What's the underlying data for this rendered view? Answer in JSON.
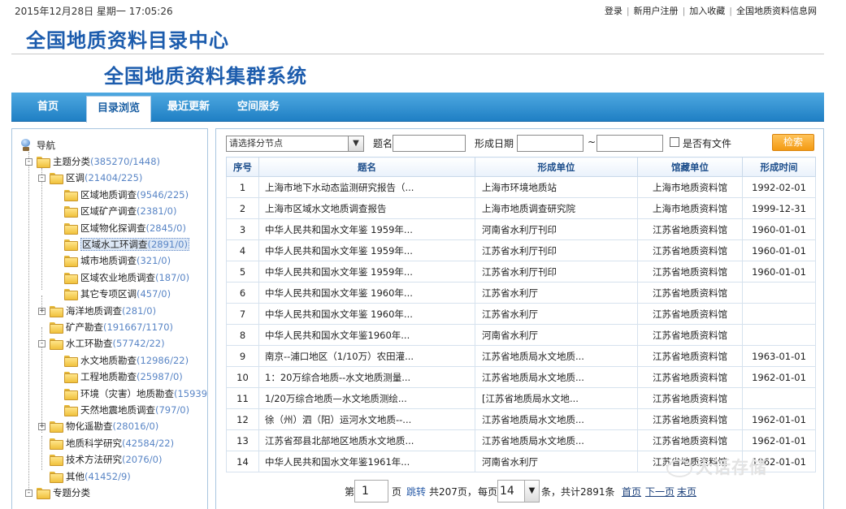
{
  "topbar": {
    "datetime": "2015年12月28日 星期一 17:05:26",
    "links": [
      "登录",
      "新用户注册",
      "加入收藏",
      "全国地质资料信息网"
    ]
  },
  "header": {
    "title1": "全国地质资料目录中心",
    "title2": "全国地质资料集群系统"
  },
  "nav": {
    "tabs": [
      "首页",
      "目录浏览",
      "最近更新",
      "空间服务"
    ],
    "active_index": 1
  },
  "sidebar": {
    "root": "导航",
    "nodes": [
      {
        "label": "主题分类",
        "count": "(385270/1448)"
      },
      {
        "label": "区调",
        "count": "(21404/225)"
      },
      {
        "label": "区域地质调查",
        "count": "(9546/225)"
      },
      {
        "label": "区域矿产调查",
        "count": "(2381/0)"
      },
      {
        "label": "区域物化探调查",
        "count": "(2845/0)"
      },
      {
        "label": "区域水工环调查",
        "count": "(2891/0)"
      },
      {
        "label": "城市地质调查",
        "count": "(321/0)"
      },
      {
        "label": "区域农业地质调查",
        "count": "(187/0)"
      },
      {
        "label": "其它专项区调",
        "count": "(457/0)"
      },
      {
        "label": "海洋地质调查",
        "count": "(281/0)"
      },
      {
        "label": "矿产勘查",
        "count": "(191667/1170)"
      },
      {
        "label": "水工环勘查",
        "count": "(57742/22)"
      },
      {
        "label": "水文地质勘查",
        "count": "(12986/22)"
      },
      {
        "label": "工程地质勘查",
        "count": "(25987/0)"
      },
      {
        "label": "环境（灾害）地质勘查",
        "count": "(15939"
      },
      {
        "label": "天然地震地质调查",
        "count": "(797/0)"
      },
      {
        "label": "物化遥勘查",
        "count": "(28016/0)"
      },
      {
        "label": "地质科学研究",
        "count": "(42584/22)"
      },
      {
        "label": "技术方法研究",
        "count": "(2076/0)"
      },
      {
        "label": "其他",
        "count": "(41452/9)"
      },
      {
        "label": "专题分类",
        "count": ""
      }
    ]
  },
  "filter": {
    "section_placeholder": "请选择分节点",
    "title_label": "题名",
    "date_label": "形成日期",
    "date_sep": "~",
    "has_file_label": "是否有文件",
    "search_button": "检索"
  },
  "table": {
    "headers": [
      "序号",
      "题名",
      "形成单位",
      "馆藏单位",
      "形成时间"
    ],
    "rows": [
      [
        "1",
        "上海市地下水动态监测研究报告（...",
        "上海市环境地质站",
        "上海市地质资料馆",
        "1992-02-01"
      ],
      [
        "2",
        "上海市区域水文地质调查报告",
        "上海市地质调查研究院",
        "上海市地质资料馆",
        "1999-12-31"
      ],
      [
        "3",
        "中华人民共和国水文年鉴 1959年...",
        "河南省水利厅刊印",
        "江苏省地质资料馆",
        "1960-01-01"
      ],
      [
        "4",
        "中华人民共和国水文年鉴 1959年...",
        "江苏省水利厅刊印",
        "江苏省地质资料馆",
        "1960-01-01"
      ],
      [
        "5",
        "中华人民共和国水文年鉴 1959年...",
        "江苏省水利厅刊印",
        "江苏省地质资料馆",
        "1960-01-01"
      ],
      [
        "6",
        "中华人民共和国水文年鉴 1960年...",
        "江苏省水利厅",
        "江苏省地质资料馆",
        ""
      ],
      [
        "7",
        "中华人民共和国水文年鉴 1960年...",
        "江苏省水利厅",
        "江苏省地质资料馆",
        ""
      ],
      [
        "8",
        "中华人民共和国水文年鉴1960年...",
        "河南省水利厅",
        "江苏省地质资料馆",
        ""
      ],
      [
        "9",
        "南京--浦口地区（1/10万）农田灌...",
        "江苏省地质局水文地质...",
        "江苏省地质资料馆",
        "1963-01-01"
      ],
      [
        "10",
        "1：20万综合地质--水文地质测量...",
        "江苏省地质局水文地质...",
        "江苏省地质资料馆",
        "1962-01-01"
      ],
      [
        "11",
        "1/20万综合地质—水文地质测绘...",
        "[江苏省地质局水文地...",
        "江苏省地质资料馆",
        ""
      ],
      [
        "12",
        "徐（州）泗（阳）运河水文地质--...",
        "江苏省地质局水文地质...",
        "江苏省地质资料馆",
        "1962-01-01"
      ],
      [
        "13",
        "江苏省邳县北部地区地质水文地质...",
        "江苏省地质局水文地质...",
        "江苏省地质资料馆",
        "1962-01-01"
      ],
      [
        "14",
        "中华人民共和国水文年鉴1961年...",
        "河南省水利厅",
        "江苏省地质资料馆",
        "1962-01-01"
      ]
    ]
  },
  "pager": {
    "page_prefix": "第",
    "page_value": "1",
    "page_suffix": "页",
    "jump": "跳转",
    "total_pages": "共207页，",
    "per_page_prefix": "每页",
    "per_page_value": "14",
    "per_page_suffix": "条，共计2891条",
    "first": "首页",
    "next": "下一页",
    "last": "末页"
  },
  "watermark": "大话存储"
}
